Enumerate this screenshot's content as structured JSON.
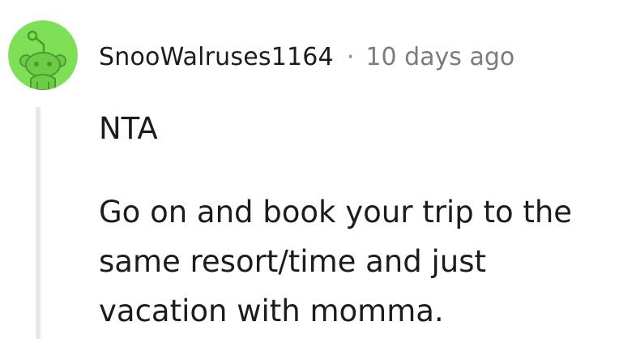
{
  "comment": {
    "author": "SnooWalruses1164",
    "separator": "·",
    "timestamp": "10 days ago",
    "avatar_icon": "snoo-avatar-icon",
    "avatar_color": "#7ee057",
    "paragraphs": [
      "NTA",
      "Go on and book your trip to the same resort/time and just vacation with momma."
    ]
  }
}
